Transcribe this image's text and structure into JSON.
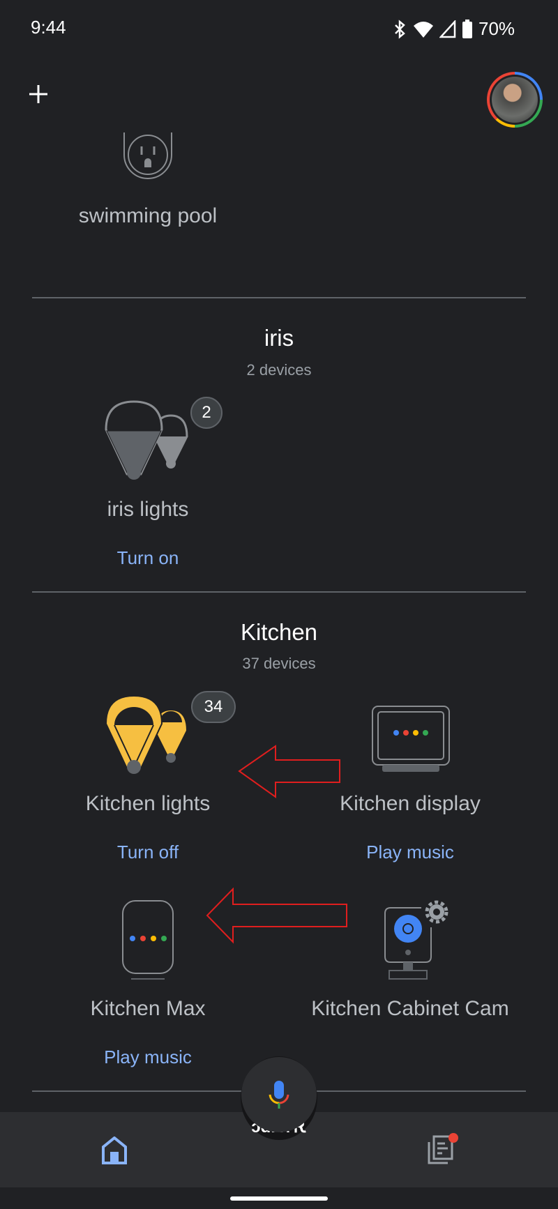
{
  "status_bar": {
    "time": "9:44",
    "battery": "70%",
    "icons": [
      "bluetooth-icon",
      "wifi-icon",
      "signal-icon",
      "battery-icon"
    ]
  },
  "header": {
    "add_icon": "plus-icon",
    "avatar": "account-avatar"
  },
  "rooms": [
    {
      "devices": [
        {
          "name": "swimming pool",
          "icon": "outlet-icon"
        }
      ]
    },
    {
      "name": "iris",
      "count": "2 devices",
      "devices": [
        {
          "name": "iris lights",
          "badge": "2",
          "action": "Turn on",
          "icon": "light-bulbs-icon"
        }
      ]
    },
    {
      "name": "Kitchen",
      "count": "37 devices",
      "devices": [
        {
          "name": "Kitchen lights",
          "badge": "34",
          "action": "Turn off",
          "icon": "light-bulbs-icon"
        },
        {
          "name": "Kitchen display",
          "action": "Play music",
          "icon": "smart-display-icon"
        },
        {
          "name": "Kitchen Max",
          "action": "Play music",
          "icon": "smart-speaker-icon"
        },
        {
          "name": "Kitchen Cabinet Cam",
          "icon": "camera-icon"
        }
      ]
    }
  ],
  "fab_label_fragment": "ɔɑı ʎ Ꭱ",
  "nav": {
    "items": [
      "home",
      "feed"
    ]
  },
  "colors": {
    "accent": "#8ab4f8",
    "bulb_on": "#f6bf41",
    "annotation_arrow": "#e01e1e",
    "bg": "#202124",
    "nav_bg": "#2d2e31"
  }
}
